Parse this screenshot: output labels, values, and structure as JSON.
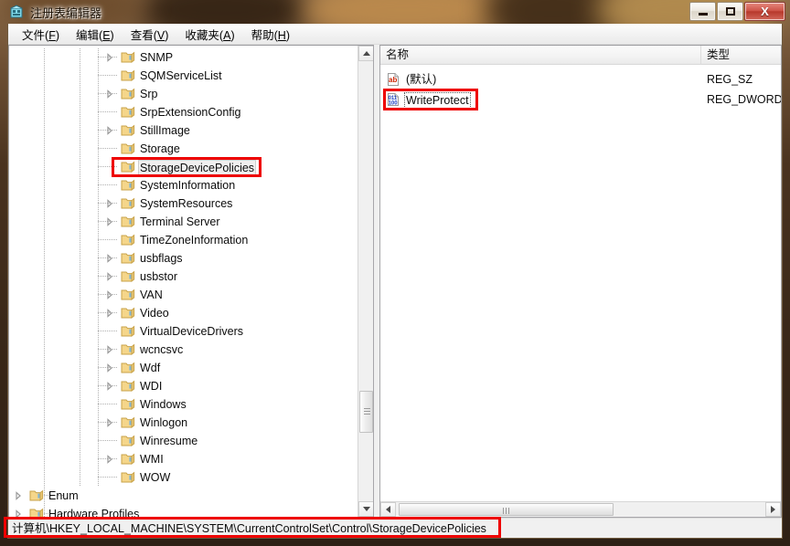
{
  "window": {
    "title": "注册表编辑器",
    "icon": "registry-editor-icon",
    "buttons": {
      "minimize": "最小化",
      "maximize": "最大化",
      "close": "X"
    }
  },
  "menubar": {
    "items": [
      {
        "label": "文件",
        "accel": "F"
      },
      {
        "label": "编辑",
        "accel": "E"
      },
      {
        "label": "查看",
        "accel": "V"
      },
      {
        "label": "收藏夹",
        "accel": "A"
      },
      {
        "label": "帮助",
        "accel": "H"
      }
    ]
  },
  "tree": {
    "nodes": [
      {
        "label": "SNMP",
        "indent": 2,
        "expandable": true,
        "selected": false
      },
      {
        "label": "SQMServiceList",
        "indent": 2,
        "expandable": false,
        "selected": false
      },
      {
        "label": "Srp",
        "indent": 2,
        "expandable": true,
        "selected": false
      },
      {
        "label": "SrpExtensionConfig",
        "indent": 2,
        "expandable": false,
        "selected": false
      },
      {
        "label": "StillImage",
        "indent": 2,
        "expandable": true,
        "selected": false
      },
      {
        "label": "Storage",
        "indent": 2,
        "expandable": false,
        "selected": false
      },
      {
        "label": "StorageDevicePolicies",
        "indent": 2,
        "expandable": false,
        "selected": true
      },
      {
        "label": "SystemInformation",
        "indent": 2,
        "expandable": false,
        "selected": false
      },
      {
        "label": "SystemResources",
        "indent": 2,
        "expandable": true,
        "selected": false
      },
      {
        "label": "Terminal Server",
        "indent": 2,
        "expandable": true,
        "selected": false
      },
      {
        "label": "TimeZoneInformation",
        "indent": 2,
        "expandable": false,
        "selected": false
      },
      {
        "label": "usbflags",
        "indent": 2,
        "expandable": true,
        "selected": false
      },
      {
        "label": "usbstor",
        "indent": 2,
        "expandable": true,
        "selected": false
      },
      {
        "label": "VAN",
        "indent": 2,
        "expandable": true,
        "selected": false
      },
      {
        "label": "Video",
        "indent": 2,
        "expandable": true,
        "selected": false
      },
      {
        "label": "VirtualDeviceDrivers",
        "indent": 2,
        "expandable": false,
        "selected": false
      },
      {
        "label": "wcncsvc",
        "indent": 2,
        "expandable": true,
        "selected": false
      },
      {
        "label": "Wdf",
        "indent": 2,
        "expandable": true,
        "selected": false
      },
      {
        "label": "WDI",
        "indent": 2,
        "expandable": true,
        "selected": false
      },
      {
        "label": "Windows",
        "indent": 2,
        "expandable": false,
        "selected": false
      },
      {
        "label": "Winlogon",
        "indent": 2,
        "expandable": true,
        "selected": false
      },
      {
        "label": "Winresume",
        "indent": 2,
        "expandable": false,
        "selected": false
      },
      {
        "label": "WMI",
        "indent": 2,
        "expandable": true,
        "selected": false
      },
      {
        "label": "WOW",
        "indent": 2,
        "expandable": false,
        "selected": false
      },
      {
        "label": "Enum",
        "indent": 1,
        "expandable": true,
        "selected": false
      },
      {
        "label": "Hardware Profiles",
        "indent": 1,
        "expandable": true,
        "selected": false
      }
    ]
  },
  "list": {
    "columns": [
      {
        "label": "名称"
      },
      {
        "label": "类型"
      }
    ],
    "rows": [
      {
        "name": "(默认)",
        "type": "REG_SZ",
        "icon": "string-value-icon",
        "focused": false
      },
      {
        "name": "WriteProtect",
        "type": "REG_DWORD",
        "icon": "dword-value-icon",
        "focused": true
      }
    ]
  },
  "statusbar": {
    "path": "计算机\\HKEY_LOCAL_MACHINE\\SYSTEM\\CurrentControlSet\\Control\\StorageDevicePolicies"
  },
  "annotations": [
    {
      "name": "annotation-storagedevicepolicies",
      "color": "#ee0000"
    },
    {
      "name": "annotation-writeprotect",
      "color": "#ee0000"
    },
    {
      "name": "annotation-registry-path",
      "color": "#ee0000"
    }
  ],
  "colors": {
    "annotation": "#ee0000",
    "titlebar_glass": "#4a331f",
    "pane_background": "#ffffff",
    "chrome": "#f0f0f0"
  }
}
